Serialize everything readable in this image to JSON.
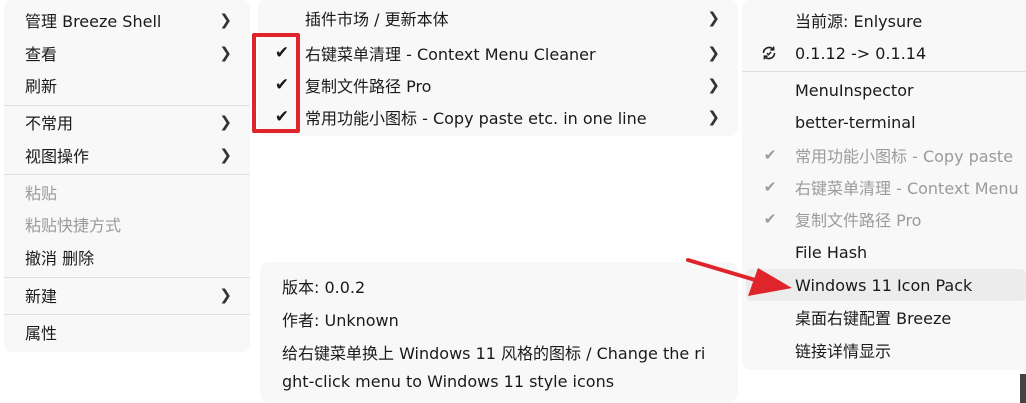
{
  "menu1": {
    "items": [
      {
        "label": "管理 Breeze Shell",
        "chevron": true
      },
      {
        "label": "查看",
        "chevron": true
      },
      {
        "label": "刷新",
        "chevron": false
      },
      {
        "label": "不常用",
        "chevron": true
      },
      {
        "label": "视图操作",
        "chevron": true
      },
      {
        "label": "粘贴",
        "disabled": true
      },
      {
        "label": "粘贴快捷方式",
        "disabled": true
      },
      {
        "label": "撤消 删除"
      },
      {
        "label": "新建",
        "chevron": true
      },
      {
        "label": "属性"
      }
    ]
  },
  "menu2": {
    "items": [
      {
        "label": "插件市场 / 更新本体",
        "chevron": true,
        "checked": false
      },
      {
        "label": "右键菜单清理 - Context Menu Cleaner",
        "chevron": true,
        "checked": true
      },
      {
        "label": "复制文件路径 Pro",
        "chevron": true,
        "checked": true
      },
      {
        "label": "常用功能小图标 - Copy paste etc. in one line",
        "chevron": true,
        "checked": true
      }
    ],
    "chevron_glyph": "›",
    "check_glyph": "✔"
  },
  "info": {
    "version": "版本: 0.0.2",
    "author": "作者: Unknown",
    "description_line1": "给右键菜单换上 Windows 11 风格的图标 / Change the ri",
    "description_line2": "ght-click menu to Windows 11 style icons"
  },
  "menu3": {
    "source": "当前源: Enlysure",
    "update": "0.1.12 -> 0.1.14",
    "items": [
      {
        "label": "MenuInspector"
      },
      {
        "label": "better-terminal"
      },
      {
        "label": "常用功能小图标 - Copy paste",
        "checked": true,
        "disabled": true
      },
      {
        "label": "右键菜单清理 - Context Menu",
        "checked": true,
        "disabled": true
      },
      {
        "label": "复制文件路径 Pro",
        "checked": true,
        "disabled": true
      },
      {
        "label": "File Hash"
      },
      {
        "label": "Windows 11 Icon Pack",
        "highlighted": true
      },
      {
        "label": "桌面右键配置 Breeze"
      },
      {
        "label": "链接详情显示"
      }
    ]
  },
  "annotation_color": "#e0242b"
}
